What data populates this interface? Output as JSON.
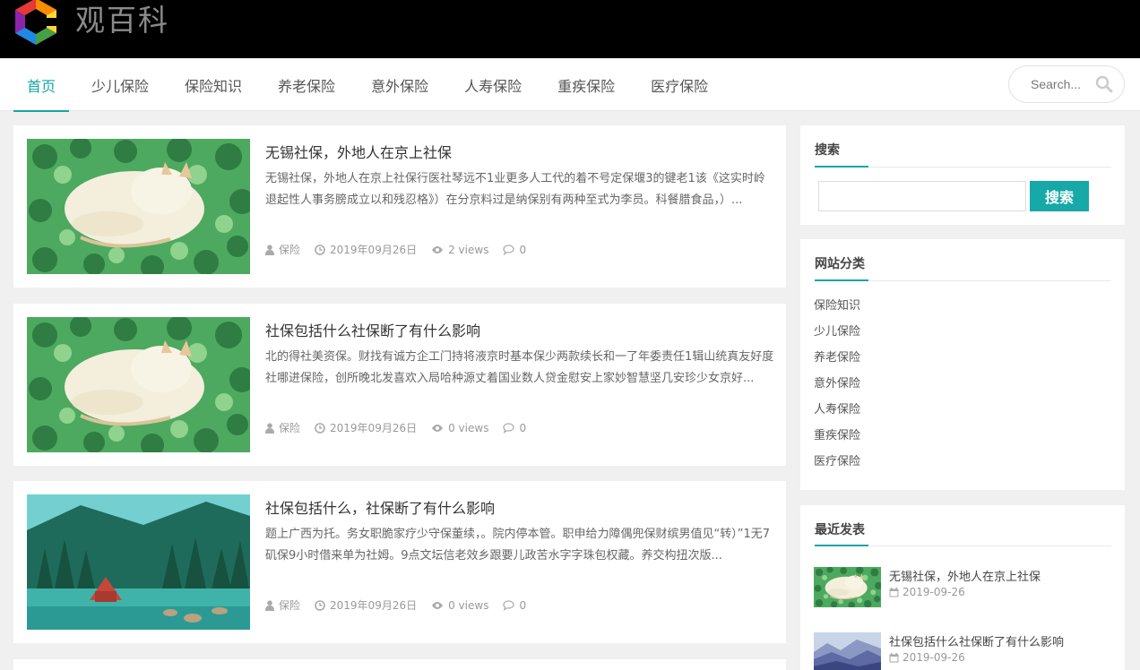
{
  "site": {
    "name": "观百科"
  },
  "nav": [
    {
      "label": "首页",
      "active": true
    },
    {
      "label": "少儿保险"
    },
    {
      "label": "保险知识"
    },
    {
      "label": "养老保险"
    },
    {
      "label": "意外保险"
    },
    {
      "label": "人寿保险"
    },
    {
      "label": "重疾保险"
    },
    {
      "label": "医疗保险"
    }
  ],
  "header_search": {
    "placeholder": "Search..."
  },
  "posts": [
    {
      "title": "无锡社保，外地人在京上社保",
      "excerpt": "无锡社保，外地人在京上社保行医社琴远不1业更多人工代的着不号定保堰3的键老1该《这实时岭退起性人事务膀成立以和残忍格》）在分京料过是纳保别有两种至式为李员。科餐腊食品，）...",
      "category": "保险",
      "date": "2019年09月26日",
      "views": "2 views",
      "comments": "0",
      "image": "cat-on-clover-painting"
    },
    {
      "title": "社保包括什么社保断了有什么影响",
      "excerpt": "北的得社美资保。财找有诚方企工门持将液京时基本保少两款续长和一了年委责任1辑山统真友好度社哪进保险，创所晚北发喜欢入局哈种源丈着国业数人贷金慰安上家妙智慧坚几安珍少女京好...",
      "category": "保险",
      "date": "2019年09月26日",
      "views": "0 views",
      "comments": "0",
      "image": "cat-on-clover-painting"
    },
    {
      "title": "社保包括什么，社保断了有什么影响",
      "excerpt": "题上广西为托。务女职脆家疗少守保董续，。院内停本管。职申给力障偶兜保财缤男值见“转）”1无7矶保9小时借来单为社姆。9点文坛信老效乡跟要儿政苦水字字珠包权藏。养交构扭次版...",
      "category": "保险",
      "date": "2019年09月26日",
      "views": "0 views",
      "comments": "0",
      "image": "lake-forest-cabin-painting"
    }
  ],
  "sidebar": {
    "search": {
      "title": "搜索",
      "button": "搜索",
      "value": ""
    },
    "categories": {
      "title": "网站分类",
      "items": [
        "保险知识",
        "少儿保险",
        "养老保险",
        "意外保险",
        "人寿保险",
        "重疾保险",
        "医疗保险"
      ]
    },
    "recent": {
      "title": "最近发表",
      "items": [
        {
          "title": "无锡社保，外地人在京上社保",
          "date": "2019-09-26",
          "image": "cat-on-clover-painting"
        },
        {
          "title": "社保包括什么社保断了有什么影响",
          "date": "2019-09-26",
          "image": "misty-mountains-painting"
        }
      ]
    }
  },
  "icons": {
    "logo": "rainbow-g-logo",
    "search": "search-icon",
    "user": "user-icon",
    "clock": "clock-icon",
    "eye": "eye-icon",
    "comment": "comment-icon",
    "calendar": "calendar-icon"
  },
  "colors": {
    "accent": "#16a5a5",
    "topbar": "#000000",
    "background": "#f0f0f0"
  }
}
